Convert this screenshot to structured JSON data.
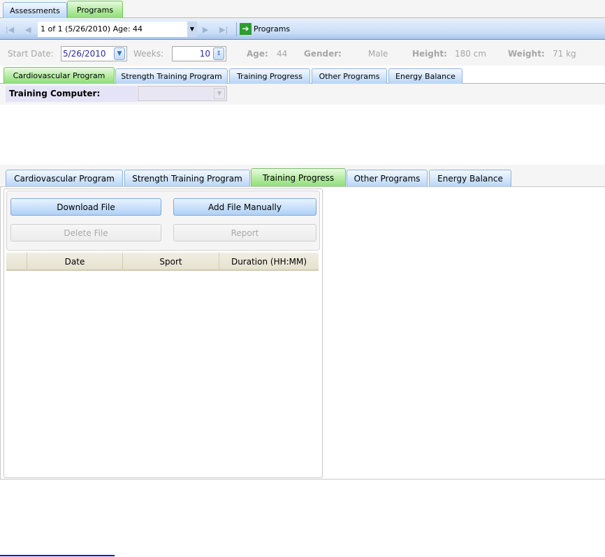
{
  "top_tabs": [
    {
      "label": "Assessments"
    },
    {
      "label": "Programs"
    }
  ],
  "toolbar": {
    "record_selector": "1 of 1 (5/26/2010) Age: 44",
    "programs_label": "Programs"
  },
  "info": {
    "start_date_label": "Start Date:",
    "start_date": "5/26/2010",
    "weeks_label": "Weeks:",
    "weeks": "10",
    "age_label": "Age:",
    "age": "44",
    "gender_label": "Gender:",
    "gender": "Male",
    "height_label": "Height:",
    "height": "180 cm",
    "weight_label": "Weight:",
    "weight": "71 kg"
  },
  "program_tabs": [
    {
      "label": "Cardiovascular Program"
    },
    {
      "label": "Strength Training Program"
    },
    {
      "label": "Training Progress"
    },
    {
      "label": "Other Programs"
    },
    {
      "label": "Energy Balance"
    }
  ],
  "training_computer_label": "Training Computer:",
  "progress": {
    "tabs": [
      {
        "label": "Cardiovascular Program"
      },
      {
        "label": "Strength Training Program"
      },
      {
        "label": "Training Progress"
      },
      {
        "label": "Other Programs"
      },
      {
        "label": "Energy Balance"
      }
    ],
    "buttons": {
      "download": "Download File",
      "add": "Add File Manually",
      "delete": "Delete File",
      "report": "Report"
    },
    "columns": [
      "Date",
      "Sport",
      "Duration (HH:MM)"
    ]
  }
}
